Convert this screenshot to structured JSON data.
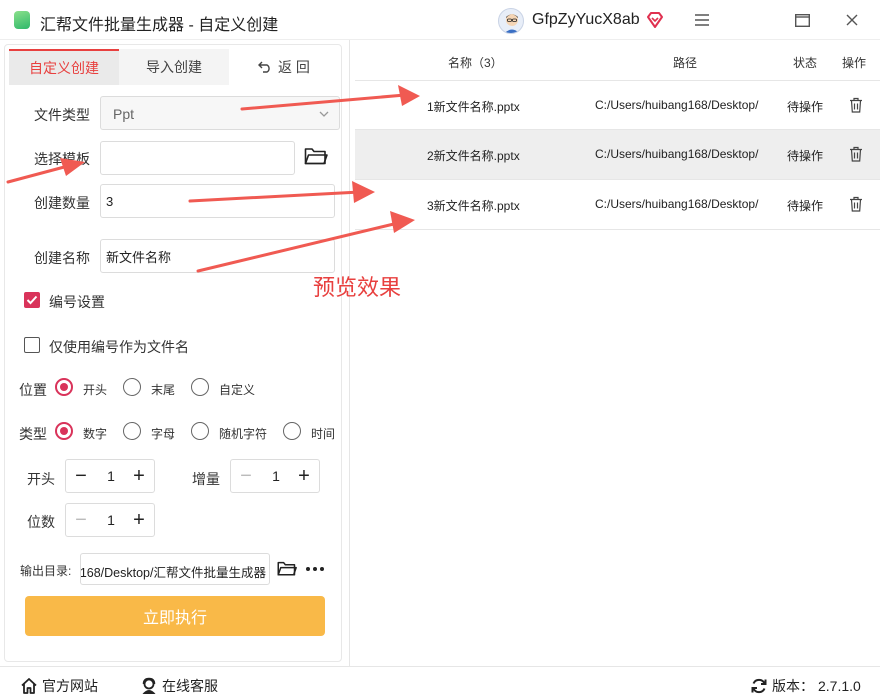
{
  "window": {
    "title": "汇帮文件批量生成器 - 自定义创建",
    "username": "GfpZyYucX8ab",
    "menu_icon": "menu-icon",
    "maximize_icon": "maximize-icon",
    "close_icon": "close-icon"
  },
  "tabs": {
    "custom": "自定义创建",
    "import": "导入创建",
    "back": "返 回"
  },
  "form": {
    "file_type_label": "文件类型",
    "file_type_value": "Ppt",
    "template_label": "选择模板",
    "template_value": "",
    "count_label": "创建数量",
    "count_value": "3",
    "name_label": "创建名称",
    "name_value": "新文件名称",
    "numbering_label": "编号设置",
    "numbering_checked": true,
    "only_number_label": "仅使用编号作为文件名",
    "only_number_checked": false,
    "position_label": "位置",
    "position_options": [
      "开头",
      "末尾",
      "自定义"
    ],
    "position_selected": "开头",
    "type_label": "类型",
    "type_options": [
      "数字",
      "字母",
      "随机字符",
      "时间"
    ],
    "type_selected": "数字",
    "start_label": "开头",
    "start_value": "1",
    "increment_label": "增量",
    "increment_value": "1",
    "digits_label": "位数",
    "digits_value": "1",
    "output_label": "输出目录:",
    "output_value": "168/Desktop/汇帮文件批量生成器",
    "run_label": "立即执行"
  },
  "table": {
    "headers": {
      "name": "名称（3）",
      "path": "路径",
      "status": "状态",
      "action": "操作"
    },
    "rows": [
      {
        "name": "1新文件名称.pptx",
        "path": "C:/Users/huibang168/Desktop/",
        "status": "待操作"
      },
      {
        "name": "2新文件名称.pptx",
        "path": "C:/Users/huibang168/Desktop/",
        "status": "待操作"
      },
      {
        "name": "3新文件名称.pptx",
        "path": "C:/Users/huibang168/Desktop/",
        "status": "待操作"
      }
    ]
  },
  "annotation": {
    "preview_text": "预览效果",
    "color": "#e8403f"
  },
  "footer": {
    "website": "官方网站",
    "support": "在线客服",
    "version_label": "版本：",
    "version_value": "2.7.1.0"
  },
  "colors": {
    "accent": "#d9335a",
    "tab_active_text": "#e8403f",
    "run_button": "#f9b948"
  }
}
